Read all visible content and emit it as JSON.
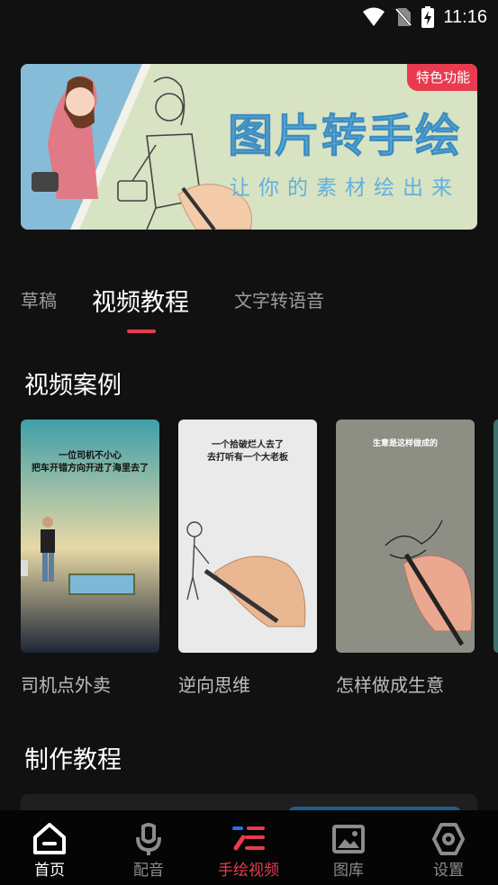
{
  "status_bar": {
    "time": "11:16"
  },
  "banner": {
    "badge": "特色功能",
    "title": "图片转手绘",
    "subtitle": "让你的素材绘出来"
  },
  "tabs": [
    {
      "label": "草稿"
    },
    {
      "label": "视频教程"
    },
    {
      "label": "文字转语音"
    }
  ],
  "sections": {
    "cases_title": "视频案例",
    "tutorial_title": "制作教程"
  },
  "cases": [
    {
      "title": "司机点外卖",
      "caption": "一位司机不小心\n把车开错方向开进了海里去了"
    },
    {
      "title": "逆向思维",
      "caption": "一个拾破烂人去了\n去打听有一个大老板"
    },
    {
      "title": "怎样做成生意",
      "caption": "生意是这样做成的"
    }
  ],
  "bottom_nav": [
    {
      "label": "首页"
    },
    {
      "label": "配音"
    },
    {
      "label": "手绘视频"
    },
    {
      "label": "图库"
    },
    {
      "label": "设置"
    }
  ],
  "colors": {
    "accent": "#e83b4f",
    "background": "#111111",
    "banner_title": "#58aee1"
  }
}
